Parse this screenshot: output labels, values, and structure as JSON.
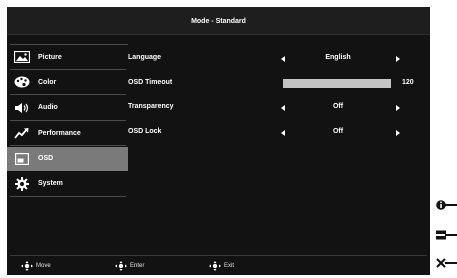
{
  "window": {
    "title": "Mode - Standard"
  },
  "sidebar": {
    "items": [
      {
        "label": "Picture",
        "icon": "picture-icon",
        "selected": false
      },
      {
        "label": "Color",
        "icon": "color-palette-icon",
        "selected": false
      },
      {
        "label": "Audio",
        "icon": "speaker-icon",
        "selected": false
      },
      {
        "label": "Performance",
        "icon": "performance-icon",
        "selected": false
      },
      {
        "label": "OSD",
        "icon": "osd-icon",
        "selected": true
      },
      {
        "label": "System",
        "icon": "gear-icon",
        "selected": false
      }
    ]
  },
  "settings": {
    "language": {
      "label": "Language",
      "value": "English"
    },
    "osd_timeout": {
      "label": "OSD Timeout",
      "value": "120",
      "level": 1.0
    },
    "transparency": {
      "label": "Transparency",
      "value": "Off"
    },
    "osd_lock": {
      "label": "OSD Lock",
      "value": "Off"
    }
  },
  "footer": {
    "move": "Move",
    "enter": "Enter",
    "exit": "Exit"
  },
  "hotkeys": [
    {
      "icon": "info-icon"
    },
    {
      "icon": "menu-icon"
    },
    {
      "icon": "close-icon"
    }
  ],
  "colors": {
    "background": "#121212",
    "selected": "#7a7a7a",
    "slider": "#b7b7b7"
  }
}
